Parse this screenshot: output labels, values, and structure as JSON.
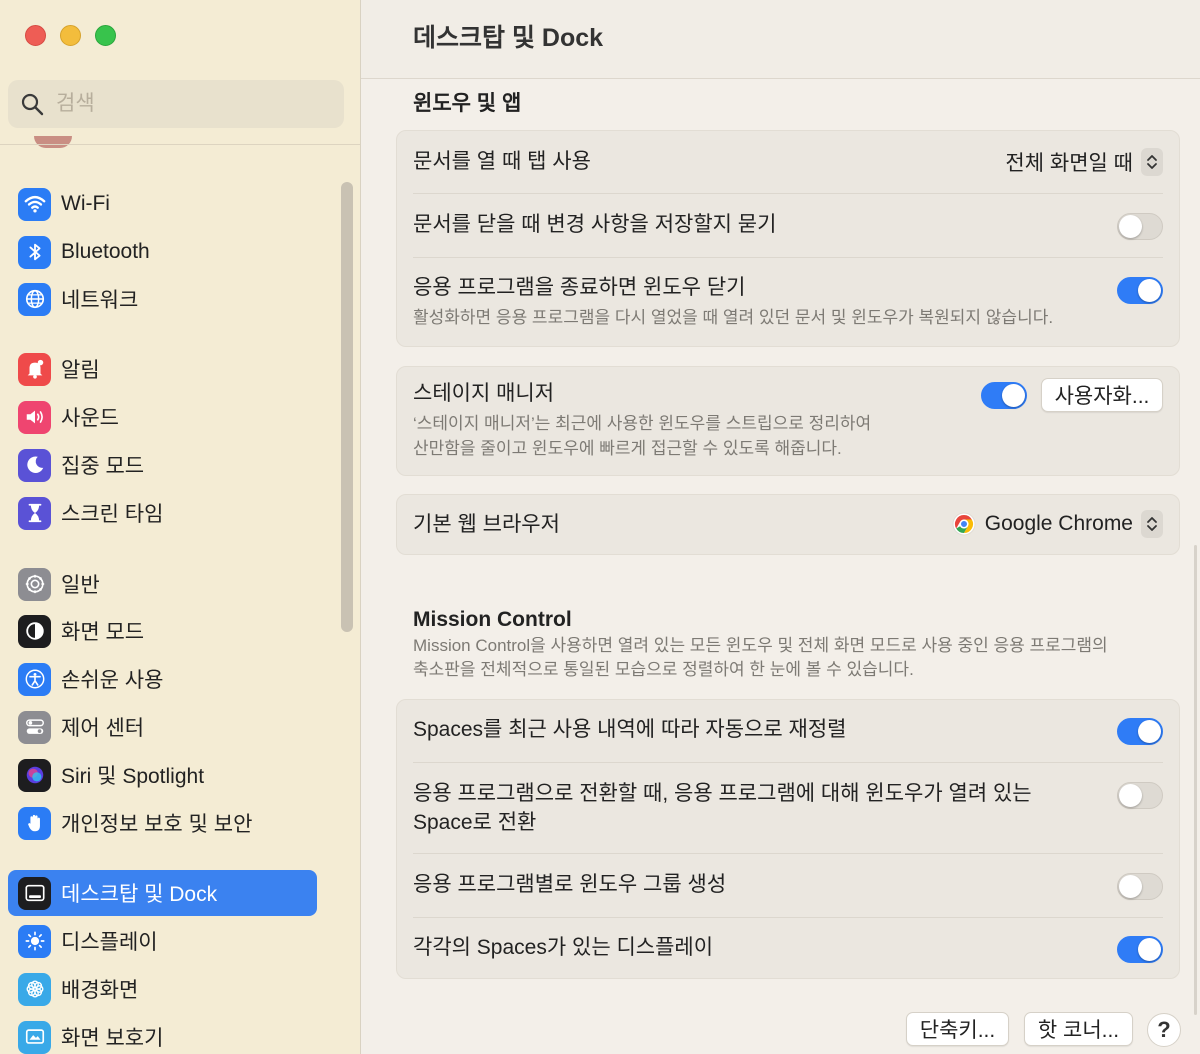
{
  "window": {
    "title": "데스크탑 및 Dock"
  },
  "sidebar": {
    "search_placeholder": "검색",
    "items": [
      {
        "label": "Wi-Fi",
        "icon": "wifi-icon",
        "color": "#2b7cf5"
      },
      {
        "label": "Bluetooth",
        "icon": "bluetooth-icon",
        "color": "#2b7cf5"
      },
      {
        "label": "네트워크",
        "icon": "globe-icon",
        "color": "#2b7cf5"
      },
      {
        "label": "알림",
        "icon": "bell-icon",
        "color": "#ef4a4a"
      },
      {
        "label": "사운드",
        "icon": "speaker-icon",
        "color": "#ef4570"
      },
      {
        "label": "집중 모드",
        "icon": "moon-icon",
        "color": "#5a52d6"
      },
      {
        "label": "스크린 타임",
        "icon": "hourglass-icon",
        "color": "#5a52d6"
      },
      {
        "label": "일반",
        "icon": "gear-icon",
        "color": "#8d8d92"
      },
      {
        "label": "화면 모드",
        "icon": "appearance-icon",
        "color": "#1d1d1f"
      },
      {
        "label": "손쉬운 사용",
        "icon": "accessibility-icon",
        "color": "#2b7cf5"
      },
      {
        "label": "제어 센터",
        "icon": "control-center-icon",
        "color": "#8d8d92"
      },
      {
        "label": "Siri 및 Spotlight",
        "icon": "siri-icon",
        "color": "#1d1d1f"
      },
      {
        "label": "개인정보 보호 및 보안",
        "icon": "hand-icon",
        "color": "#2b7cf5"
      },
      {
        "label": "데스크탑 및 Dock",
        "icon": "dock-icon",
        "color": "#1d1d1f",
        "active": true
      },
      {
        "label": "디스플레이",
        "icon": "sun-icon",
        "color": "#2b7cf5"
      },
      {
        "label": "배경화면",
        "icon": "flower-icon",
        "color": "#39a9e8"
      },
      {
        "label": "화면 보호기",
        "icon": "screensaver-icon",
        "color": "#39a9e8"
      }
    ]
  },
  "windows_apps": {
    "heading": "윈도우 및 앱",
    "prefer_tabs_label": "문서를 열 때 탭 사용",
    "prefer_tabs_value": "전체 화면일 때",
    "ask_keep_changes_label": "문서를 닫을 때 변경 사항을 저장할지 묻기",
    "ask_keep_changes_on": false,
    "close_windows_label": "응용 프로그램을 종료하면 윈도우 닫기",
    "close_windows_sub": "활성화하면 응용 프로그램을 다시 열었을 때 열려 있던 문서 및 윈도우가 복원되지 않습니다.",
    "close_windows_on": true
  },
  "stage_manager": {
    "label": "스테이지 매니저",
    "sub1": "‘스테이지 매니저’는 최근에 사용한 윈도우를 스트립으로 정리하여",
    "sub2": "산만함을 줄이고 윈도우에 빠르게 접근할 수 있도록 해줍니다.",
    "on": true,
    "customize_label": "사용자화..."
  },
  "browser": {
    "label": "기본 웹 브라우저",
    "value": "Google Chrome",
    "icon": "chrome-icon"
  },
  "mission_control": {
    "heading": "Mission Control",
    "desc1": "Mission Control을 사용하면 열려 있는 모든 윈도우 및 전체 화면 모드로 사용 중인 응용 프로그램의",
    "desc2": "축소판을 전체적으로 통일된 모습으로 정렬하여 한 눈에 볼 수 있습니다.",
    "rearrange_label": "Spaces를 최근 사용 내역에 따라 자동으로 재정렬",
    "rearrange_on": true,
    "switch_space_label1": "응용 프로그램으로 전환할 때, 응용 프로그램에 대해 윈도우가 열려 있는",
    "switch_space_label2": "Space로 전환",
    "switch_space_on": false,
    "group_windows_label": "응용 프로그램별로 윈도우 그룹 생성",
    "group_windows_on": false,
    "separate_spaces_label": "각각의 Spaces가 있는 디스플레이",
    "separate_spaces_on": true
  },
  "footer": {
    "shortcuts_label": "단축키...",
    "hot_corners_label": "핫 코너...",
    "help_label": "?"
  },
  "colors": {
    "accent": "#2f7cf6",
    "sidebar_bg": "#f4ecd4"
  }
}
